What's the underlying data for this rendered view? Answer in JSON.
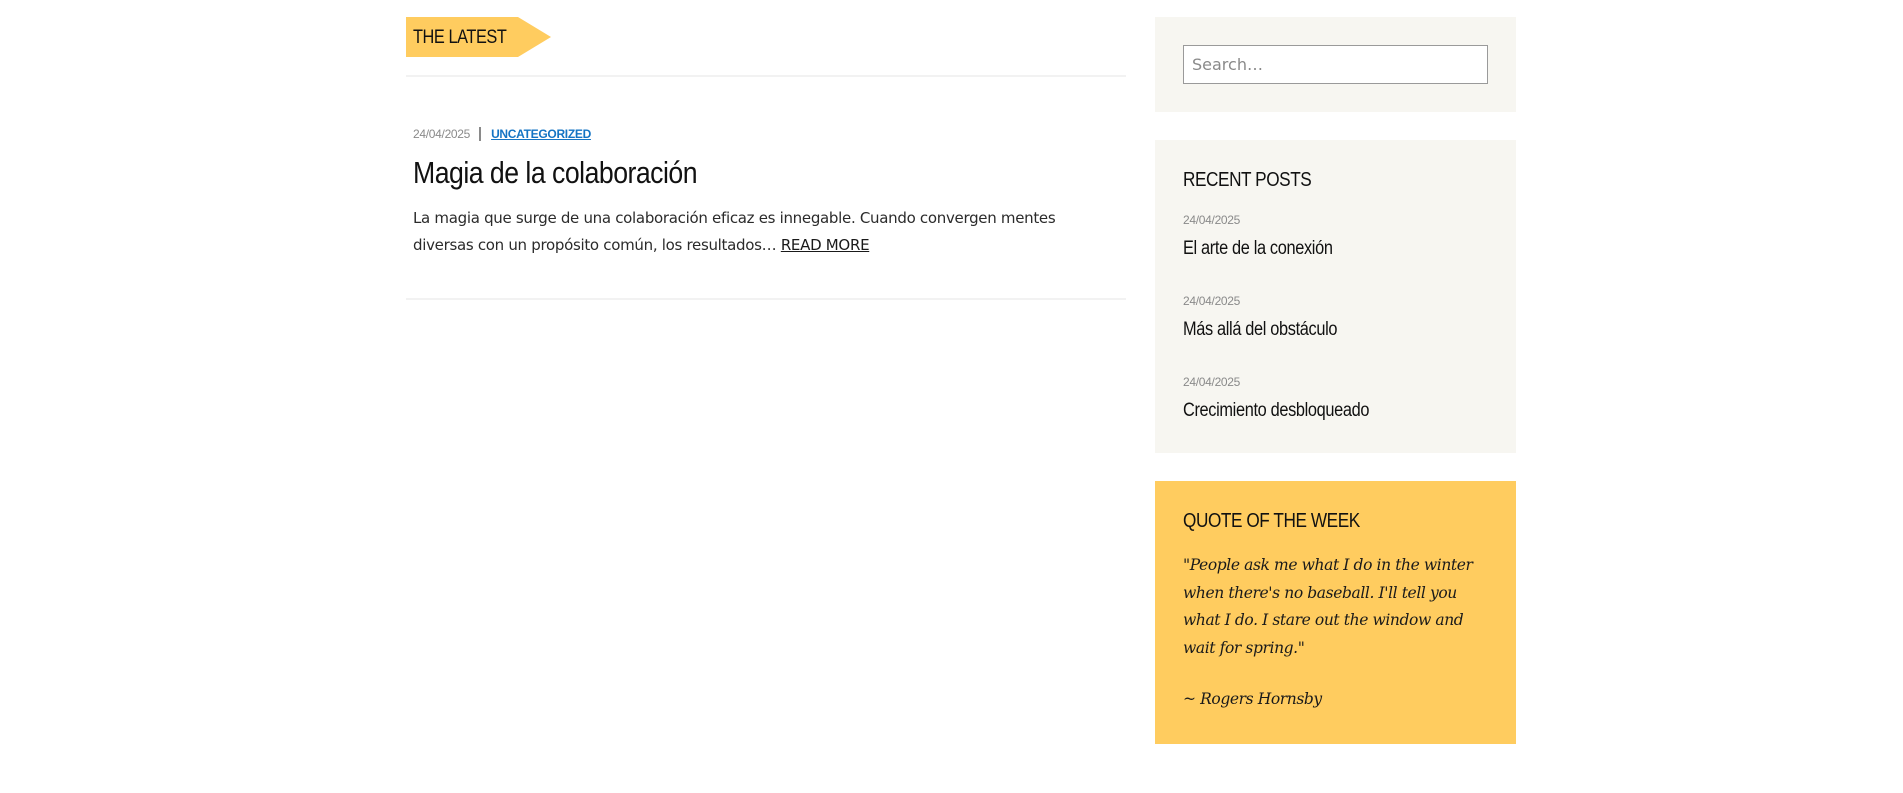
{
  "main": {
    "section_label": "THE LATEST",
    "post": {
      "date": "24/04/2025",
      "category": "UNCATEGORIZED",
      "title": "Magia de la colaboración",
      "excerpt": "La magia que surge de una colaboración eficaz es innegable. Cuando convergen mentes diversas con un propósito común, los resultados… ",
      "read_more": "READ MORE"
    }
  },
  "sidebar": {
    "search": {
      "placeholder": "Search…"
    },
    "recent_posts": {
      "title": "RECENT POSTS",
      "items": [
        {
          "date": "24/04/2025",
          "title": "El arte de la conexión"
        },
        {
          "date": "24/04/2025",
          "title": "Más allá del obstáculo"
        },
        {
          "date": "24/04/2025",
          "title": "Crecimiento desbloqueado"
        }
      ]
    },
    "quote": {
      "title": "QUOTE OF THE WEEK",
      "text": "\"People ask me what I do in the winter when there's no baseball. I'll tell you what I do. I stare out the window and wait for spring.\"",
      "author": "~ Rogers Hornsby"
    }
  },
  "colors": {
    "accent": "#ffcc5f",
    "widget_bg": "#f7f6f1",
    "link": "#1474c4"
  }
}
